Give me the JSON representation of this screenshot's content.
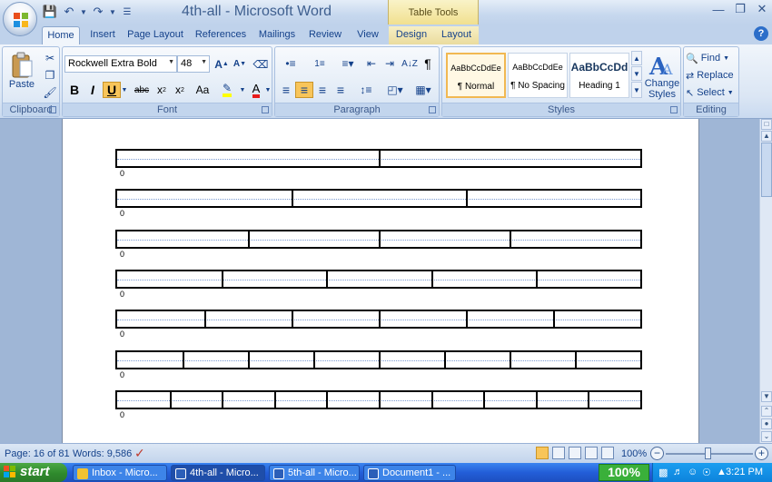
{
  "window": {
    "title": "4th-all - Microsoft Word",
    "contextual_tab_group": "Table Tools"
  },
  "tabs": [
    "Home",
    "Insert",
    "Page Layout",
    "References",
    "Mailings",
    "Review",
    "View",
    "Design",
    "Layout"
  ],
  "ribbon": {
    "clipboard": {
      "label": "Clipboard",
      "paste": "Paste"
    },
    "font": {
      "label": "Font",
      "name": "Rockwell Extra Bold",
      "size": "48"
    },
    "paragraph": {
      "label": "Paragraph"
    },
    "styles": {
      "label": "Styles",
      "tiles": [
        {
          "preview": "AaBbCcDdEe",
          "name": "¶ Normal"
        },
        {
          "preview": "AaBbCcDdEe",
          "name": "¶ No Spacing"
        },
        {
          "preview": "AaBbCcDd",
          "name": "Heading 1"
        }
      ],
      "change_styles": "Change Styles"
    },
    "editing": {
      "label": "Editing",
      "find": "Find",
      "replace": "Replace",
      "select": "Select"
    }
  },
  "document": {
    "tables": [
      {
        "columns": 2
      },
      {
        "columns": 3
      },
      {
        "columns": 4
      },
      {
        "columns": 5
      },
      {
        "columns": 6
      },
      {
        "columns": 8
      },
      {
        "columns": 10
      }
    ],
    "paragraph_mark": "0"
  },
  "status": {
    "page": "Page: 16 of 81",
    "words": "Words: 9,586",
    "zoom": "100%"
  },
  "taskbar": {
    "start": "start",
    "items": [
      "Inbox - Micro...",
      "4th-all - Micro...",
      "5th-all - Micro...",
      "Document1 - ..."
    ],
    "zoom_badge": "100%",
    "clock": "3:21 PM"
  }
}
